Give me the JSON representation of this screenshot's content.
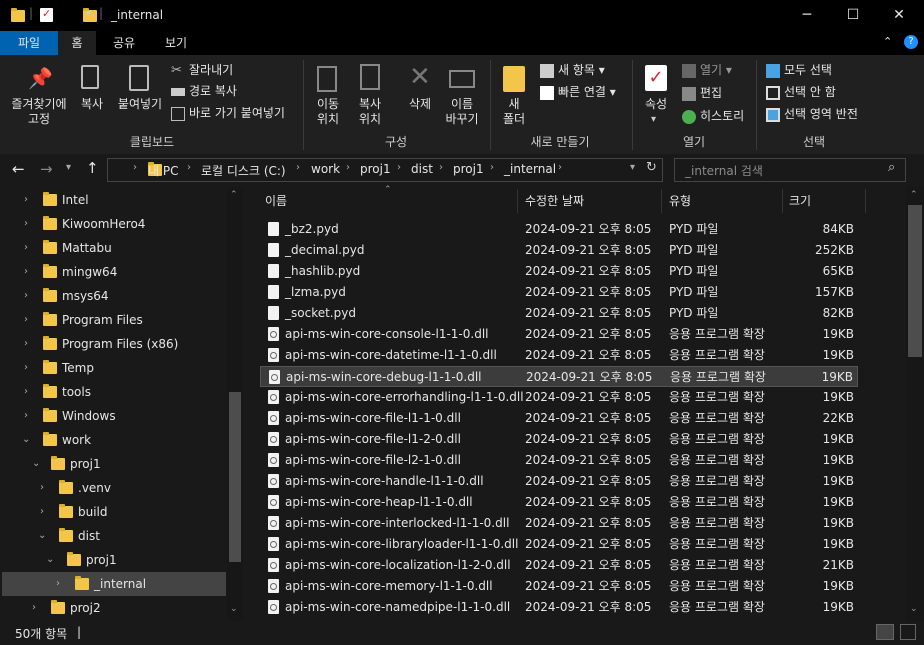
{
  "window": {
    "title": "_internal",
    "minimize": "─",
    "maximize": "☐",
    "close": "✕"
  },
  "ribbon_tabs": [
    {
      "label": "파일",
      "active": false
    },
    {
      "label": "홈",
      "active": true
    },
    {
      "label": "공유",
      "active": false
    },
    {
      "label": "보기",
      "active": false
    }
  ],
  "ribbon": {
    "pin": "즐겨찾기에\n고정",
    "copy": "복사",
    "paste": "붙여넣기",
    "cut": "잘라내기",
    "copy_path": "경로 복사",
    "paste_shortcut": "바로 가기 붙여넣기",
    "clipboard_group": "클립보드",
    "move_to": "이동\n위치",
    "copy_to": "복사\n위치",
    "delete": "삭제",
    "rename": "이름\n바꾸기",
    "organize_group": "구성",
    "new_folder": "새\n폴더",
    "new_item": "새 항목",
    "easy_access": "빠른 연결",
    "new_group": "새로 만들기",
    "properties": "속성",
    "open": "열기",
    "edit": "편집",
    "history": "히스토리",
    "open_group": "열기",
    "select_all": "모두 선택",
    "select_none": "선택 안 함",
    "invert_selection": "선택 영역 반전",
    "select_group": "선택"
  },
  "address": {
    "crumbs": [
      "내 PC",
      "로컬 디스크 (C:)",
      "work",
      "proj1",
      "dist",
      "proj1",
      "_internal"
    ],
    "search_placeholder": "_internal 검색"
  },
  "nav": [
    {
      "label": "Intel"
    },
    {
      "label": "KiwoomHero4"
    },
    {
      "label": "Mattabu"
    },
    {
      "label": "mingw64"
    },
    {
      "label": "msys64"
    },
    {
      "label": "Program Files"
    },
    {
      "label": "Program Files (x86)"
    },
    {
      "label": "Temp"
    },
    {
      "label": "tools"
    },
    {
      "label": "Windows"
    },
    {
      "label": "work"
    },
    {
      "label": "proj1"
    },
    {
      "label": ".venv"
    },
    {
      "label": "build"
    },
    {
      "label": "dist"
    },
    {
      "label": "proj1"
    },
    {
      "label": "_internal"
    },
    {
      "label": "proj2"
    }
  ],
  "columns": {
    "name": "이름",
    "date": "수정한 날짜",
    "type": "유형",
    "size": "크기"
  },
  "files": [
    {
      "name": "_bz2.pyd",
      "date": "2024-09-21 오후 8:05",
      "type": "PYD 파일",
      "size": "84KB"
    },
    {
      "name": "_decimal.pyd",
      "date": "2024-09-21 오후 8:05",
      "type": "PYD 파일",
      "size": "252KB"
    },
    {
      "name": "_hashlib.pyd",
      "date": "2024-09-21 오후 8:05",
      "type": "PYD 파일",
      "size": "65KB"
    },
    {
      "name": "_lzma.pyd",
      "date": "2024-09-21 오후 8:05",
      "type": "PYD 파일",
      "size": "157KB"
    },
    {
      "name": "_socket.pyd",
      "date": "2024-09-21 오후 8:05",
      "type": "PYD 파일",
      "size": "82KB"
    },
    {
      "name": "api-ms-win-core-console-l1-1-0.dll",
      "date": "2024-09-21 오후 8:05",
      "type": "응용 프로그램 확장",
      "size": "19KB"
    },
    {
      "name": "api-ms-win-core-datetime-l1-1-0.dll",
      "date": "2024-09-21 오후 8:05",
      "type": "응용 프로그램 확장",
      "size": "19KB"
    },
    {
      "name": "api-ms-win-core-debug-l1-1-0.dll",
      "date": "2024-09-21 오후 8:05",
      "type": "응용 프로그램 확장",
      "size": "19KB"
    },
    {
      "name": "api-ms-win-core-errorhandling-l1-1-0.dll",
      "date": "2024-09-21 오후 8:05",
      "type": "응용 프로그램 확장",
      "size": "19KB"
    },
    {
      "name": "api-ms-win-core-file-l1-1-0.dll",
      "date": "2024-09-21 오후 8:05",
      "type": "응용 프로그램 확장",
      "size": "22KB"
    },
    {
      "name": "api-ms-win-core-file-l1-2-0.dll",
      "date": "2024-09-21 오후 8:05",
      "type": "응용 프로그램 확장",
      "size": "19KB"
    },
    {
      "name": "api-ms-win-core-file-l2-1-0.dll",
      "date": "2024-09-21 오후 8:05",
      "type": "응용 프로그램 확장",
      "size": "19KB"
    },
    {
      "name": "api-ms-win-core-handle-l1-1-0.dll",
      "date": "2024-09-21 오후 8:05",
      "type": "응용 프로그램 확장",
      "size": "19KB"
    },
    {
      "name": "api-ms-win-core-heap-l1-1-0.dll",
      "date": "2024-09-21 오후 8:05",
      "type": "응용 프로그램 확장",
      "size": "19KB"
    },
    {
      "name": "api-ms-win-core-interlocked-l1-1-0.dll",
      "date": "2024-09-21 오후 8:05",
      "type": "응용 프로그램 확장",
      "size": "19KB"
    },
    {
      "name": "api-ms-win-core-libraryloader-l1-1-0.dll",
      "date": "2024-09-21 오후 8:05",
      "type": "응용 프로그램 확장",
      "size": "19KB"
    },
    {
      "name": "api-ms-win-core-localization-l1-2-0.dll",
      "date": "2024-09-21 오후 8:05",
      "type": "응용 프로그램 확장",
      "size": "21KB"
    },
    {
      "name": "api-ms-win-core-memory-l1-1-0.dll",
      "date": "2024-09-21 오후 8:05",
      "type": "응용 프로그램 확장",
      "size": "19KB"
    },
    {
      "name": "api-ms-win-core-namedpipe-l1-1-0.dll",
      "date": "2024-09-21 오후 8:05",
      "type": "응용 프로그램 확장",
      "size": "19KB"
    }
  ],
  "status": {
    "count": "50개 항목",
    "cursor": "|"
  },
  "colors": {
    "accent": "#0063b1",
    "folder": "#f3c64a",
    "background": "#191919"
  }
}
